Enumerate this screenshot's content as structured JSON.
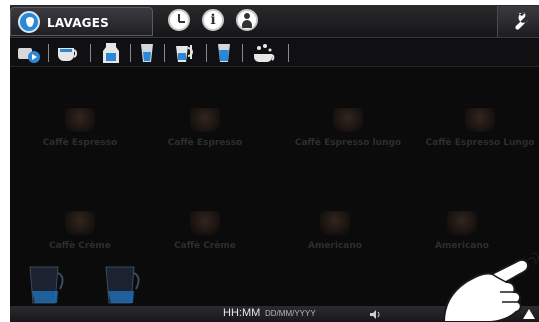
{
  "header": {
    "active_tab_label": "LAVAGES",
    "tabs": [
      "water-drop-icon",
      "clock-icon",
      "info-icon",
      "person-icon"
    ],
    "settings_icon": "wrench-icon"
  },
  "categories": [
    {
      "icon": "coffee-pods-icon"
    },
    {
      "icon": "cup-icon"
    },
    {
      "icon": "milk-carton-icon"
    },
    {
      "icon": "glass-icon"
    },
    {
      "icon": "milk-pitcher-icon"
    },
    {
      "icon": "water-glass-icon"
    },
    {
      "icon": "cleaning-icon"
    }
  ],
  "drinks": [
    {
      "label": "Caffè Espresso"
    },
    {
      "label": "Caffè Espresso"
    },
    {
      "label": "Caffè Espresso lungo"
    },
    {
      "label": "Caffè Espresso Lungo"
    },
    {
      "label": "Caffè Crème"
    },
    {
      "label": "Caffè Crème"
    },
    {
      "label": "Americano"
    },
    {
      "label": "Americano"
    }
  ],
  "status_bar": {
    "time": "HH:MM",
    "date": "DD/MM/YYYY",
    "volume_icon": "speaker-icon",
    "scroll_icon": "up-arrow-icon"
  },
  "colors": {
    "accent_blue": "#2c87d6",
    "background": "#0b0b0c",
    "bar": "#1e1e21"
  }
}
